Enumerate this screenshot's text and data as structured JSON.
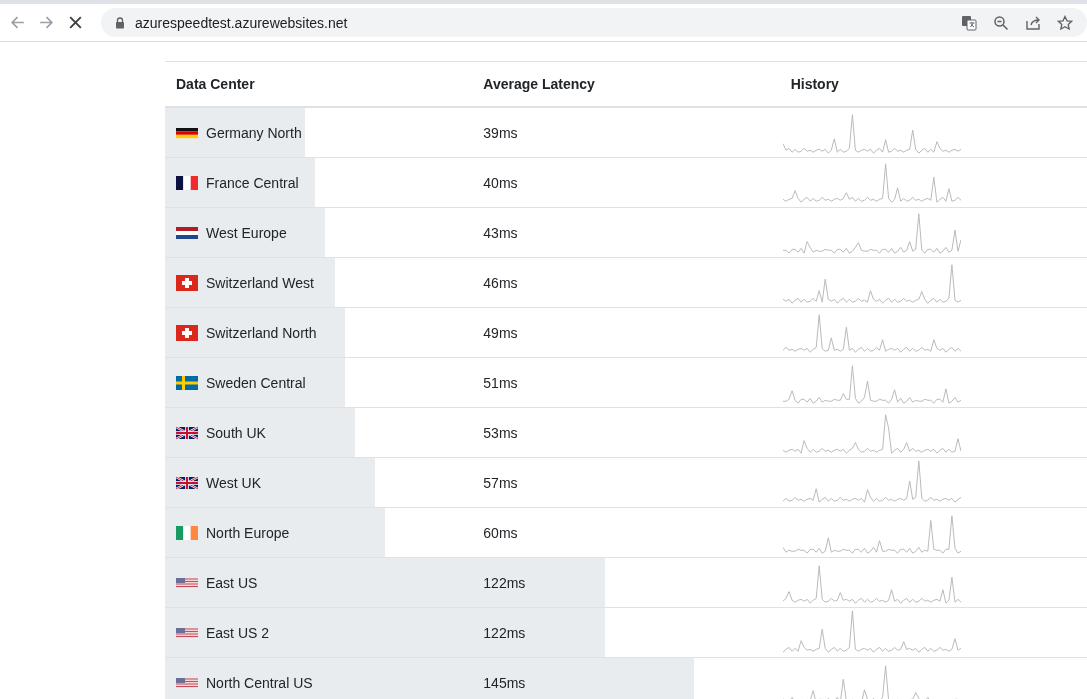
{
  "browser": {
    "url": "azurespeedtest.azurewebsites.net"
  },
  "table": {
    "columns": [
      "Data Center",
      "Average Latency",
      "History"
    ],
    "rows": [
      {
        "kind": "de",
        "name": "Germany North",
        "latency": "39ms",
        "level": 0.152
      },
      {
        "kind": "fr",
        "name": "France Central",
        "latency": "40ms",
        "level": 0.163
      },
      {
        "kind": "nl",
        "name": "West Europe",
        "latency": "43ms",
        "level": 0.174
      },
      {
        "kind": "ch",
        "name": "Switzerland West",
        "latency": "46ms",
        "level": 0.184
      },
      {
        "kind": "ch",
        "name": "Switzerland North",
        "latency": "49ms",
        "level": 0.195
      },
      {
        "kind": "se",
        "name": "Sweden Central",
        "latency": "51ms",
        "level": 0.195
      },
      {
        "kind": "gb",
        "name": "South UK",
        "latency": "53ms",
        "level": 0.206
      },
      {
        "kind": "gb",
        "name": "West UK",
        "latency": "57ms",
        "level": 0.228
      },
      {
        "kind": "ie",
        "name": "North Europe",
        "latency": "60ms",
        "level": 0.239
      },
      {
        "kind": "us",
        "name": "East US",
        "latency": "122ms",
        "level": 0.477
      },
      {
        "kind": "us",
        "name": "East US 2",
        "latency": "122ms",
        "level": 0.477
      },
      {
        "kind": "us",
        "name": "North Central US",
        "latency": "145ms",
        "level": 0.574
      }
    ]
  }
}
